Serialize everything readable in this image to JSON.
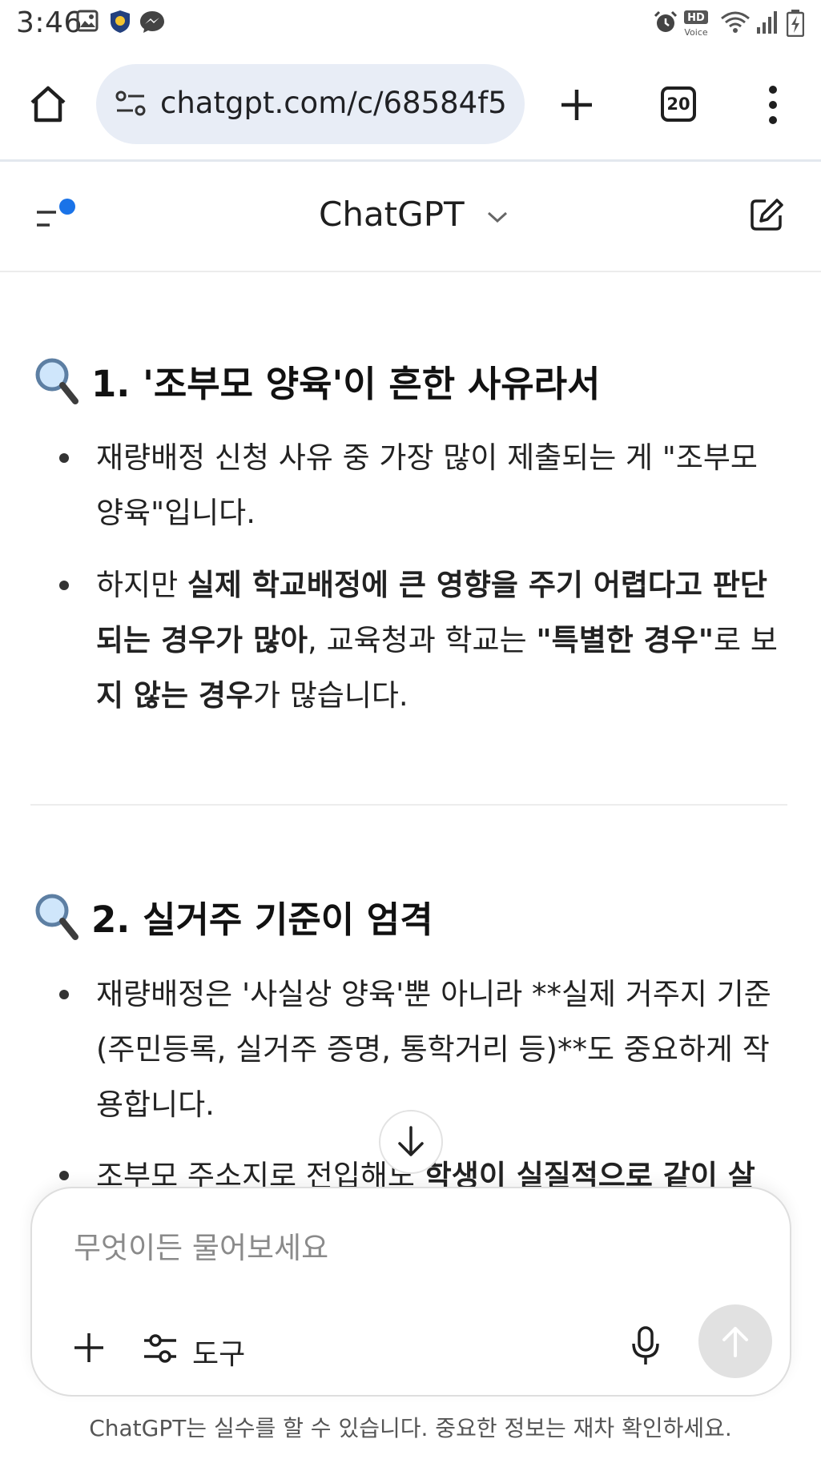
{
  "status_bar": {
    "time": "3:46",
    "icons": [
      "gallery-icon",
      "shield-app-icon",
      "messenger-icon",
      "alarm-icon",
      "hd-voice-icon",
      "wifi-icon",
      "signal-icon",
      "battery-icon"
    ]
  },
  "browser": {
    "url": "chatgpt.com/c/68584f5",
    "tab_count": "20",
    "icons": [
      "home-icon",
      "site-info-icon",
      "new-tab-icon",
      "tab-switcher-icon",
      "more-icon"
    ]
  },
  "header": {
    "title": "ChatGPT",
    "icons": [
      "sidebar-menu-icon",
      "chevron-down-icon",
      "new-chat-icon"
    ]
  },
  "content": {
    "section1": {
      "heading": "1. '조부모 양육'이 흔한 사유라서",
      "bullet1": {
        "line1": "재량배정 신청 사유 중 가장 많이 제출되는 게 \"조부모",
        "line2": "양육\"입니다."
      },
      "bullet2": {
        "l1_normal": "하지만 ",
        "l1_bold": "실제 학교배정에 큰 영향을 주기 어렵다고 판단",
        "l2_bold": "되는 경우가 많아",
        "l2_normal": ", 교육청과 학교는 ",
        "l2_bold2": "\"특별한 경우\"",
        "l2_normal2": "로 보",
        "l3_bold": "지 않는 경우",
        "l3_normal": "가 많습니다."
      }
    },
    "section2": {
      "heading": "2. 실거주 기준이 엄격",
      "bullet1": {
        "line1": "재량배정은 '사실상 양육'뿐 아니라 **실제 거주지 기준",
        "line2": "(주민등록, 실거주 증명, 통학거리 등)**도 중요하게 작",
        "line3": "용합니다."
      },
      "bullet2": {
        "normal": "조부모 주소지로 전입해도 ",
        "bold": "학생이 실질적으로 같이 살"
      }
    }
  },
  "composer": {
    "placeholder": "무엇이든 물어보세요",
    "tools_label": "도구",
    "icons": [
      "plus-icon",
      "tools-sliders-icon",
      "microphone-icon",
      "send-arrow-icon"
    ]
  },
  "disclaimer": "ChatGPT는 실수를 할 수 있습니다. 중요한 정보는 재차 확인하세요.",
  "colors": {
    "url_bar_bg": "#e8edf6",
    "notification_dot": "#1a73e8",
    "send_button_bg": "#e1e1e1",
    "text": "#1f1f1f"
  }
}
